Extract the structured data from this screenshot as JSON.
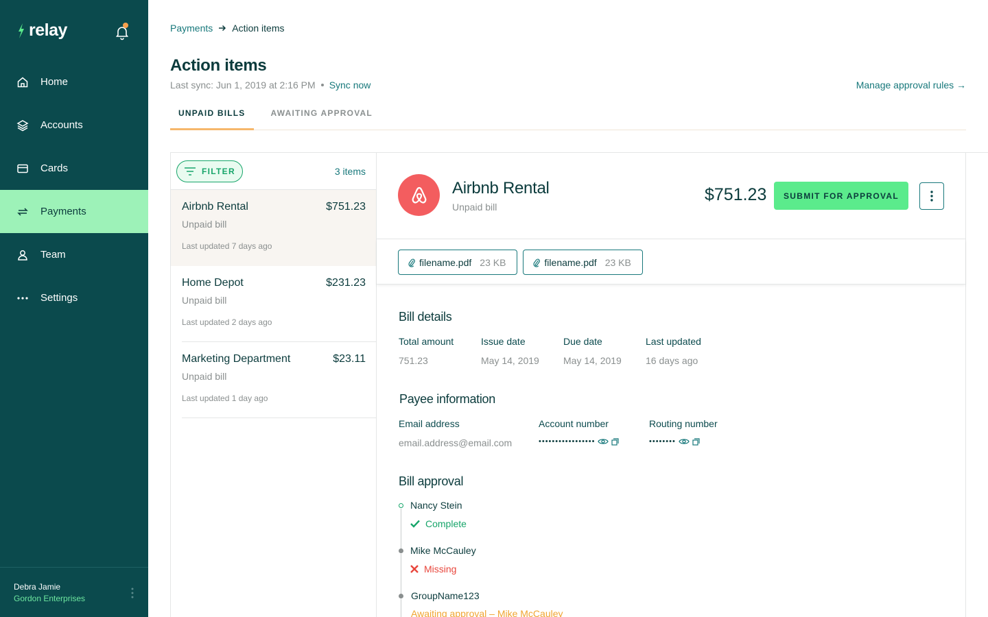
{
  "app": {
    "logo_text": "relay"
  },
  "sidebar": {
    "items": [
      {
        "label": "Home",
        "icon": "home-icon"
      },
      {
        "label": "Accounts",
        "icon": "layers-icon"
      },
      {
        "label": "Cards",
        "icon": "card-icon"
      },
      {
        "label": "Payments",
        "icon": "transfer-icon",
        "active": true
      },
      {
        "label": "Team",
        "icon": "person-icon"
      },
      {
        "label": "Settings",
        "icon": "more-horizontal-icon"
      }
    ],
    "user": {
      "name": "Debra Jamie",
      "org": "Gordon Enterprises"
    }
  },
  "breadcrumb": {
    "parent": "Payments",
    "current": "Action items"
  },
  "header": {
    "title": "Action items",
    "last_sync": "Last sync: Jun 1, 2019 at 2:16 PM",
    "sync_now": "Sync now",
    "manage_rules": "Manage approval rules →"
  },
  "tabs": [
    {
      "label": "UNPAID BILLS",
      "active": true
    },
    {
      "label": "AWAITING APPROVAL",
      "active": false
    }
  ],
  "list": {
    "filter_label": "FILTER",
    "count": "3 items",
    "bills": [
      {
        "vendor": "Airbnb Rental",
        "amount": "$751.23",
        "status": "Unpaid bill",
        "updated": "Last updated 7 days ago",
        "selected": true
      },
      {
        "vendor": "Home Depot",
        "amount": "$231.23",
        "status": "Unpaid bill",
        "updated": "Last updated 2 days ago",
        "selected": false
      },
      {
        "vendor": "Marketing Department",
        "amount": "$23.11",
        "status": "Unpaid bill",
        "updated": "Last updated 1 day ago",
        "selected": false
      }
    ]
  },
  "detail": {
    "vendor": "Airbnb Rental",
    "status": "Unpaid bill",
    "amount": "$751.23",
    "submit_label": "SUBMIT FOR APPROVAL",
    "attachments": [
      {
        "name": "filename.pdf",
        "size": "23 KB"
      },
      {
        "name": "filename.pdf",
        "size": "23 KB"
      }
    ],
    "bill_details": {
      "title": "Bill details",
      "total_amount_label": "Total amount",
      "total_amount": "751.23",
      "issue_date_label": "Issue date",
      "issue_date": "May 14, 2019",
      "due_date_label": "Due date",
      "due_date": "May 14, 2019",
      "last_updated_label": "Last updated",
      "last_updated": "16 days ago"
    },
    "payee": {
      "title": "Payee information",
      "email_label": "Email address",
      "email": "email.address@email.com",
      "account_label": "Account number",
      "account_masked": "•••••••••••••••••",
      "routing_label": "Routing number",
      "routing_masked": "••••••••"
    },
    "approval": {
      "title": "Bill approval",
      "approvers": [
        {
          "name": "Nancy Stein",
          "status": "Complete"
        },
        {
          "name": "Mike McCauley",
          "status": "Missing"
        },
        {
          "name": "GroupName123",
          "status": "Awaiting approval – Mike McCauley"
        }
      ]
    }
  },
  "colors": {
    "sidebar_bg": "#0b4a4d",
    "active_nav": "#9df2b8",
    "accent_teal": "#17787b",
    "submit_green": "#5beb8c",
    "complete": "#17a56a",
    "missing": "#e8463c",
    "awaiting": "#f0a531",
    "airbnb": "#f35d5f",
    "bell_dot": "#f6a04d"
  }
}
